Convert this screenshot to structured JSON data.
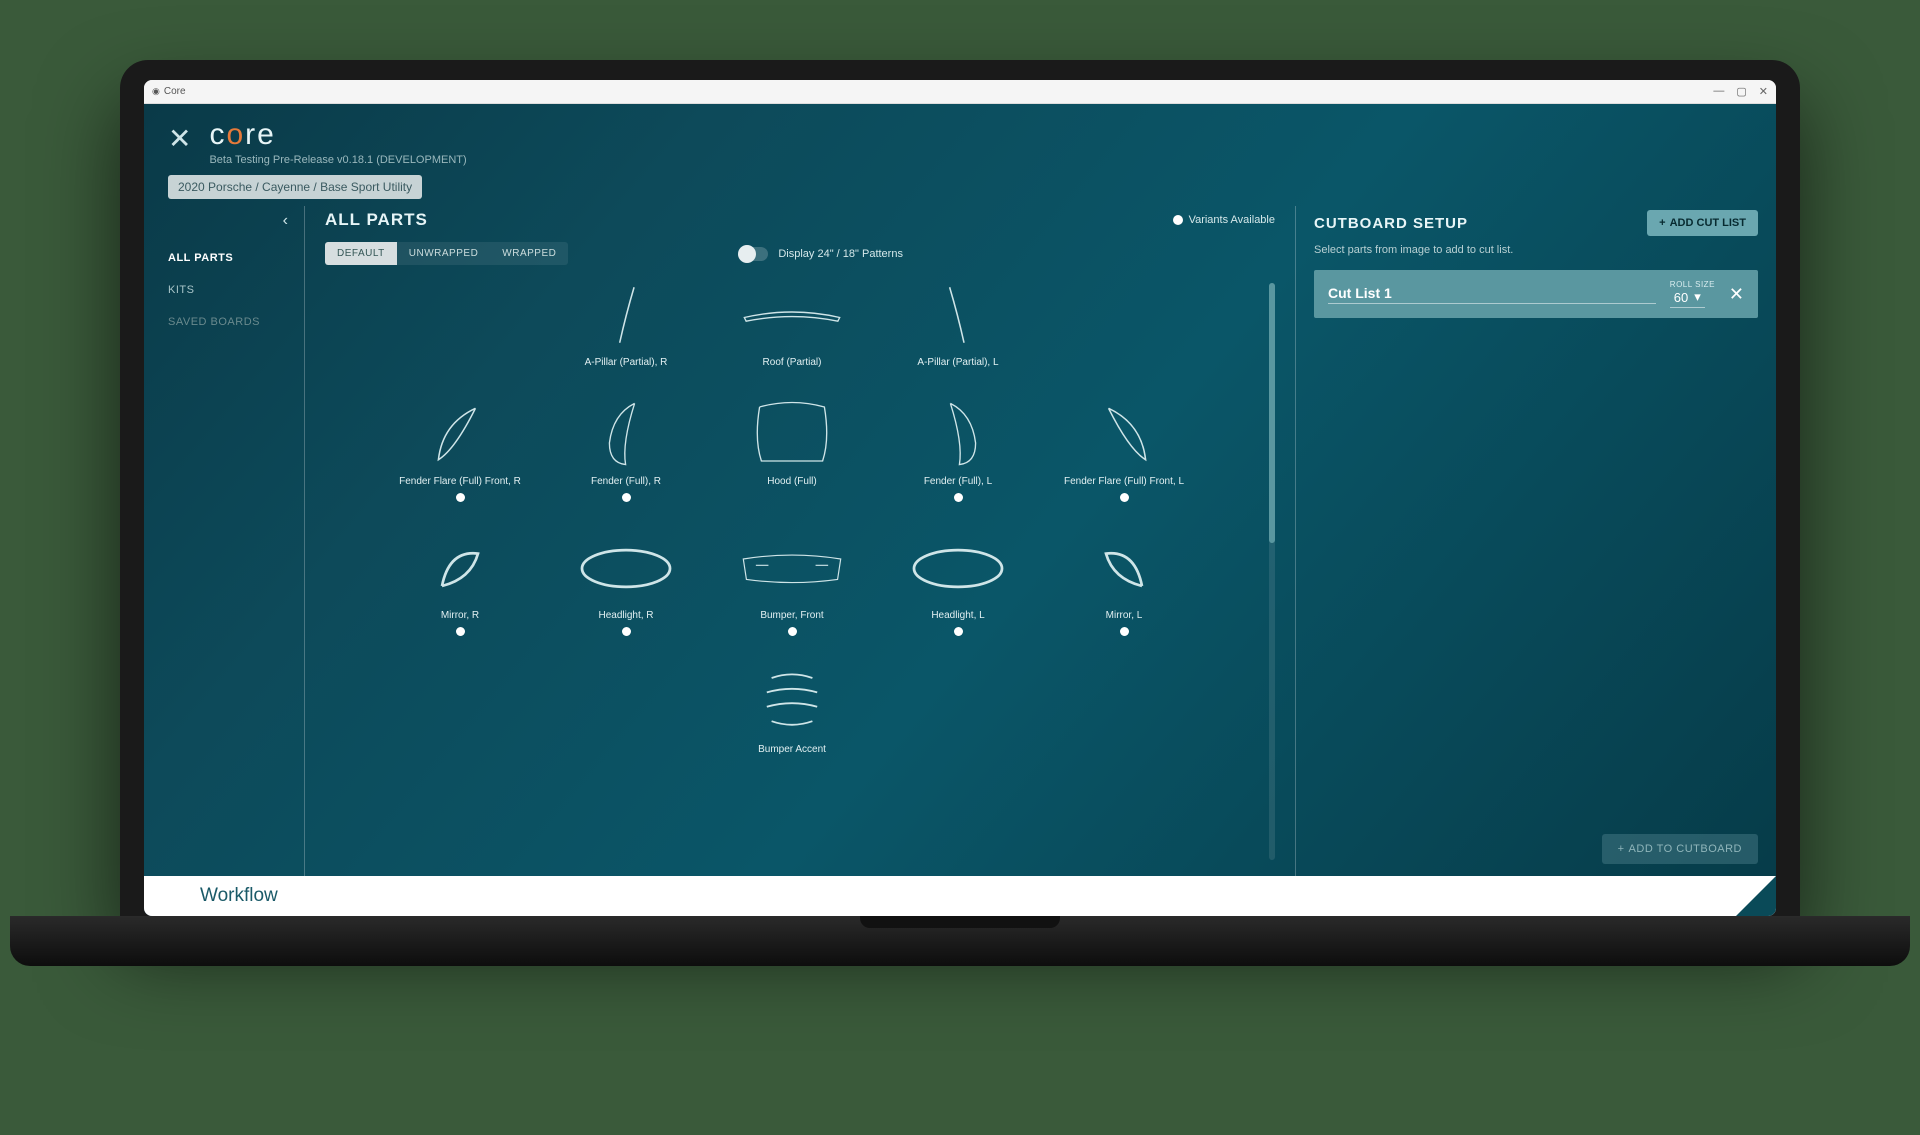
{
  "window": {
    "title": "Core"
  },
  "brand": {
    "logo_prefix": "c",
    "logo_mid": "o",
    "logo_suffix": "re",
    "subtitle": "Beta Testing Pre-Release v0.18.1 (DEVELOPMENT)"
  },
  "breadcrumb": "2020 Porsche / Cayenne / Base Sport Utility",
  "sidebar": {
    "items": [
      {
        "label": "ALL PARTS",
        "active": true
      },
      {
        "label": "KITS"
      },
      {
        "label": "SAVED BOARDS",
        "dim": true
      }
    ]
  },
  "parts": {
    "title": "ALL PARTS",
    "variants_label": "Variants Available",
    "segments": [
      "DEFAULT",
      "UNWRAPPED",
      "WRAPPED"
    ],
    "segment_active": 0,
    "toggle_label": "Display 24\" / 18\" Patterns",
    "rows": [
      [
        {
          "label": "A-Pillar (Partial), R",
          "variant": false,
          "shape": "pillarR"
        },
        {
          "label": "Roof (Partial)",
          "variant": false,
          "shape": "roof"
        },
        {
          "label": "A-Pillar (Partial), L",
          "variant": false,
          "shape": "pillarL"
        }
      ],
      [
        {
          "label": "Fender Flare (Full) Front, R",
          "variant": true,
          "shape": "flareR"
        },
        {
          "label": "Fender (Full), R",
          "variant": true,
          "shape": "fenderR"
        },
        {
          "label": "Hood (Full)",
          "variant": false,
          "shape": "hood"
        },
        {
          "label": "Fender (Full), L",
          "variant": true,
          "shape": "fenderL"
        },
        {
          "label": "Fender Flare (Full) Front, L",
          "variant": true,
          "shape": "flareL"
        }
      ],
      [
        {
          "label": "Mirror, R",
          "variant": true,
          "shape": "mirrorR"
        },
        {
          "label": "Headlight, R",
          "variant": true,
          "shape": "headlight"
        },
        {
          "label": "Bumper, Front",
          "variant": true,
          "shape": "bumper"
        },
        {
          "label": "Headlight, L",
          "variant": true,
          "shape": "headlight"
        },
        {
          "label": "Mirror, L",
          "variant": true,
          "shape": "mirrorL"
        }
      ],
      [
        {
          "label": "Bumper Accent",
          "variant": false,
          "shape": "accent"
        }
      ]
    ]
  },
  "cut": {
    "title": "CUTBOARD SETUP",
    "add_label": "ADD CUT LIST",
    "hint": "Select parts from image to add to cut list.",
    "list": {
      "name": "Cut List 1",
      "roll_label": "ROLL SIZE",
      "roll_value": "60"
    },
    "footer_label": "ADD TO CUTBOARD"
  },
  "footer": "Workflow"
}
